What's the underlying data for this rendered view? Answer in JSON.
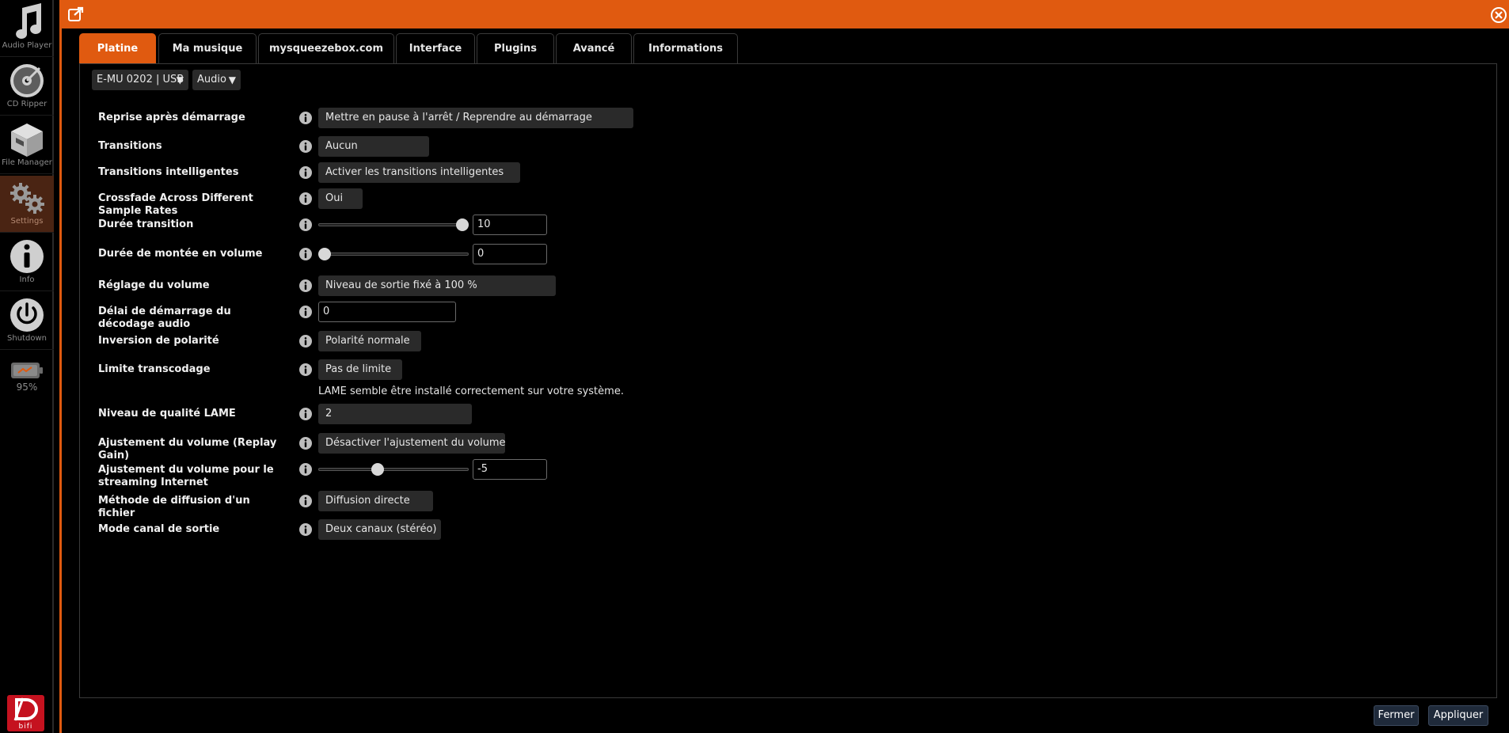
{
  "sidebar": {
    "items": [
      {
        "label": "Audio Player",
        "icon": "music-note-icon"
      },
      {
        "label": "CD Ripper",
        "icon": "cd-icon"
      },
      {
        "label": "File Manager",
        "icon": "box-icon"
      },
      {
        "label": "Settings",
        "icon": "gears-icon",
        "active": true
      },
      {
        "label": "Info",
        "icon": "info-circle-icon"
      },
      {
        "label": "Shutdown",
        "icon": "power-icon"
      }
    ],
    "battery": {
      "level": "95%",
      "icon": "battery-icon"
    },
    "logo_text": "bifi"
  },
  "window": {
    "titlebar_color": "#e05a10",
    "accent": "#e05a10"
  },
  "tabs": [
    {
      "label": "Platine",
      "active": true
    },
    {
      "label": "Ma musique"
    },
    {
      "label": "mysqueezebox.com"
    },
    {
      "label": "Interface"
    },
    {
      "label": "Plugins"
    },
    {
      "label": "Avancé"
    },
    {
      "label": "Informations"
    }
  ],
  "device": {
    "player": "E-MU 0202 | USB",
    "category": "Audio"
  },
  "settings": {
    "reprise": {
      "label": "Reprise après démarrage",
      "value": "Mettre en pause à l'arrêt / Reprendre au démarrage"
    },
    "transitions": {
      "label": "Transitions",
      "value": "Aucun"
    },
    "smart_transitions": {
      "label": "Transitions intelligentes",
      "value": "Activer les transitions intelligentes"
    },
    "crossfade": {
      "label": "Crossfade Across Different Sample Rates",
      "value": "Oui"
    },
    "transition_duration": {
      "label": "Durée transition",
      "value": "10",
      "slider_fraction": 1.0
    },
    "volume_ramp": {
      "label": "Durée de montée en volume",
      "value": "0",
      "slider_fraction": 0.0
    },
    "volume_control": {
      "label": "Réglage du volume",
      "value": "Niveau de sortie fixé à 100 %"
    },
    "decode_delay": {
      "label": "Délai de démarrage du décodage audio",
      "value": "0"
    },
    "polarity": {
      "label": "Inversion de polarité",
      "value": "Polarité normale"
    },
    "transcode_limit": {
      "label": "Limite transcodage",
      "value": "Pas de limite"
    },
    "lame_note": "LAME semble être installé correctement sur votre système.",
    "lame_quality": {
      "label": "Niveau de qualité LAME",
      "value": "2"
    },
    "replay_gain": {
      "label": "Ajustement du volume (Replay Gain)",
      "value": "Désactiver l'ajustement du volume"
    },
    "stream_volume": {
      "label": "Ajustement du volume pour le streaming Internet",
      "value": "-5",
      "slider_fraction": 0.385
    },
    "stream_method": {
      "label": "Méthode de diffusion d'un fichier",
      "value": "Diffusion directe"
    },
    "channel_mode": {
      "label": "Mode canal de sortie",
      "value": "Deux canaux (stéréo)"
    }
  },
  "footer": {
    "close_label": "Fermer",
    "apply_label": "Appliquer"
  }
}
